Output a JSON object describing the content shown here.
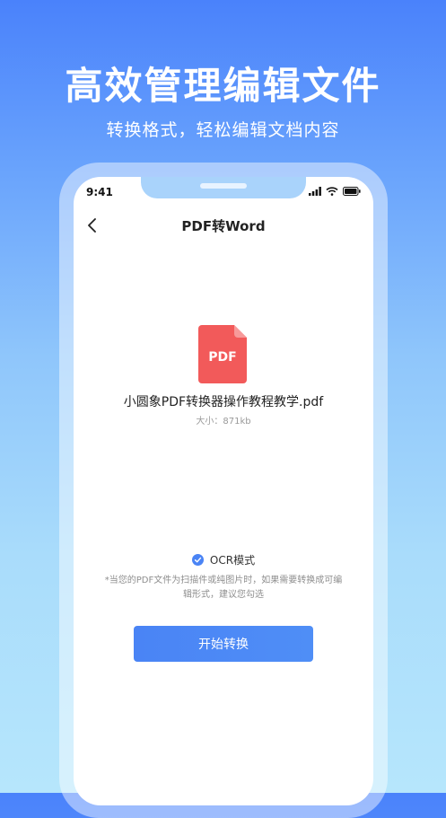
{
  "promo": {
    "title": "高效管理编辑文件",
    "subtitle": "转换格式，轻松编辑文档内容"
  },
  "status_bar": {
    "time": "9:41",
    "icons": [
      "signal-icon",
      "wifi-icon",
      "battery-icon"
    ]
  },
  "nav": {
    "back_icon": "chevron-left-icon",
    "title": "PDF转Word"
  },
  "file": {
    "icon_label": "PDF",
    "icon_color": "#f25a5a",
    "name": "小圆象PDF转换器操作教程教学.pdf",
    "size": "大小：871kb"
  },
  "ocr": {
    "checked": true,
    "label": "OCR模式",
    "hint": "*当您的PDF文件为扫描件或纯图片时，如果需要转换成可编辑形式，建议您勾选"
  },
  "action": {
    "start_label": "开始转换",
    "color": "#4a84f5"
  }
}
